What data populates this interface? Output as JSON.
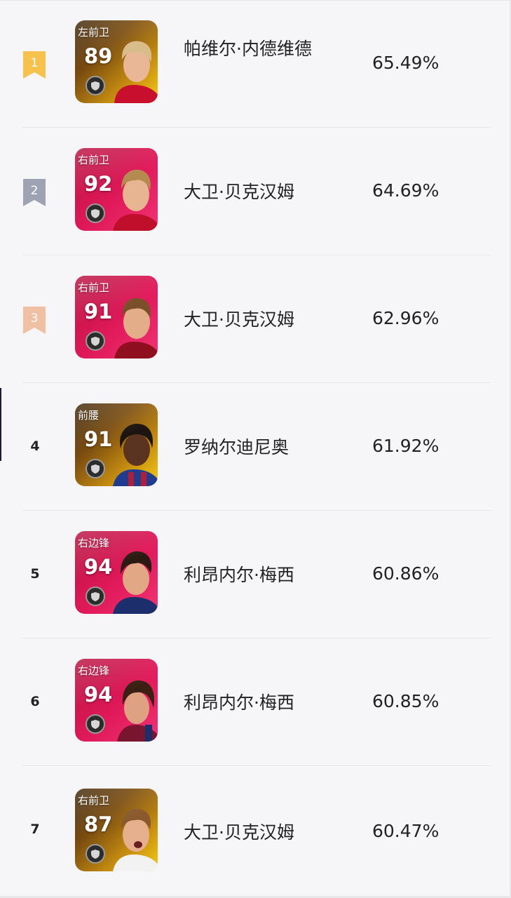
{
  "colors": {
    "gold_badge": "#f7c14d",
    "silver_badge": "#9da3b2",
    "bronze_badge": "#f0c0a4",
    "gold_card": "#c68d10",
    "red_card": "#e0195a"
  },
  "players": [
    {
      "rank": "1",
      "position": "左前卫",
      "rating": "89",
      "name": "帕维尔·内德维德",
      "rate": "65.49%",
      "card": "gold",
      "badge": "gold"
    },
    {
      "rank": "2",
      "position": "右前卫",
      "rating": "92",
      "name": "大卫·贝克汉姆",
      "rate": "64.69%",
      "card": "red",
      "badge": "silver"
    },
    {
      "rank": "3",
      "position": "右前卫",
      "rating": "91",
      "name": "大卫·贝克汉姆",
      "rate": "62.96%",
      "card": "red",
      "badge": "bronze"
    },
    {
      "rank": "4",
      "position": "前腰",
      "rating": "91",
      "name": "罗纳尔迪尼奥",
      "rate": "61.92%",
      "card": "gold",
      "badge": ""
    },
    {
      "rank": "5",
      "position": "右边锋",
      "rating": "94",
      "name": "利昂内尔·梅西",
      "rate": "60.86%",
      "card": "red",
      "badge": ""
    },
    {
      "rank": "6",
      "position": "右边锋",
      "rating": "94",
      "name": "利昂内尔·梅西",
      "rate": "60.85%",
      "card": "red",
      "badge": ""
    },
    {
      "rank": "7",
      "position": "右前卫",
      "rating": "87",
      "name": "大卫·贝克汉姆",
      "rate": "60.47%",
      "card": "gold",
      "badge": ""
    }
  ],
  "icons": {
    "badge": "ribbon-bookmark-icon",
    "emblem": "shield-icon",
    "portrait": "player-portrait"
  }
}
